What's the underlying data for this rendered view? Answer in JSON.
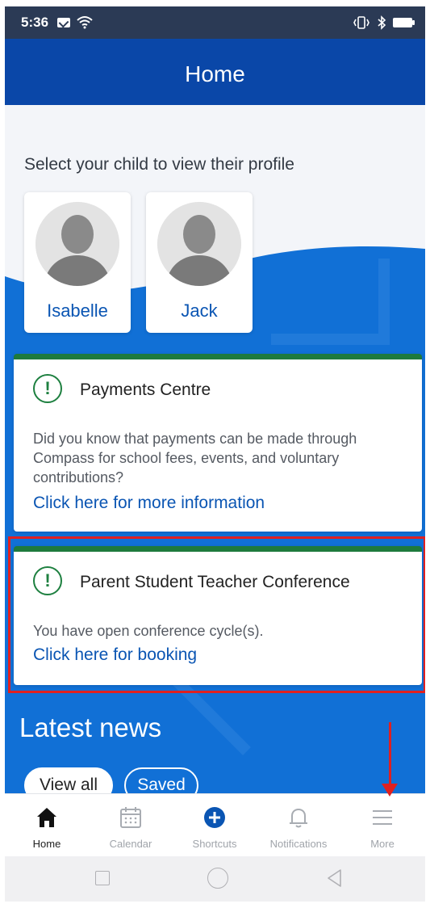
{
  "status_bar": {
    "time": "5:36",
    "icons": [
      "mail-icon",
      "wifi-icon",
      "vibrate-icon",
      "bluetooth-icon",
      "battery-icon"
    ]
  },
  "header": {
    "title": "Home"
  },
  "children_section": {
    "prompt": "Select your child to view their profile",
    "children": [
      {
        "name": "Isabelle"
      },
      {
        "name": "Jack"
      }
    ]
  },
  "cards": [
    {
      "icon": "alert-circle-icon",
      "title": "Payments Centre",
      "body": "Did you know that payments can be made through Compass for school fees, events, and voluntary contributions?",
      "link": "Click here for more information"
    },
    {
      "icon": "alert-circle-icon",
      "title": "Parent Student Teacher Conference",
      "body": "You have open conference cycle(s).",
      "link": "Click here for booking"
    }
  ],
  "news": {
    "title": "Latest news",
    "filters": [
      "View all",
      "Saved"
    ],
    "selected_filter": "View all"
  },
  "bottom_nav": {
    "active": "Home",
    "items": [
      {
        "label": "Home",
        "icon": "home-icon"
      },
      {
        "label": "Calendar",
        "icon": "calendar-icon"
      },
      {
        "label": "Shortcuts",
        "icon": "plus-circle-icon"
      },
      {
        "label": "Notifications",
        "icon": "bell-icon"
      },
      {
        "label": "More",
        "icon": "menu-icon"
      }
    ]
  },
  "system_nav": [
    "recents-button",
    "home-button",
    "back-button"
  ],
  "colors": {
    "header_blue": "#0a47a8",
    "content_blue": "#1170d6",
    "link_blue": "#0a55b3",
    "alert_green": "#1e8040",
    "annotation_red": "#e02020"
  }
}
